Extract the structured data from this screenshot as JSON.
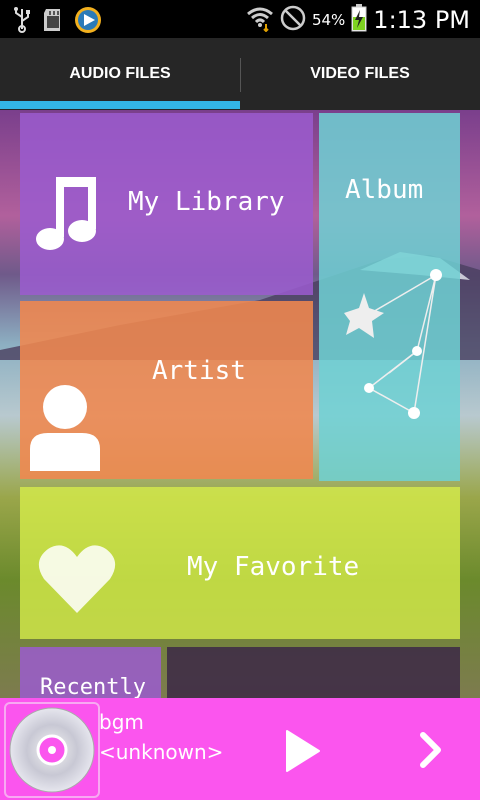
{
  "status_bar": {
    "battery_percent": "54%",
    "time": "1:13 PM",
    "icons": [
      "usb-icon",
      "sd-card-icon",
      "media-app-icon",
      "wifi-icon",
      "no-signal-icon",
      "battery-charging-icon"
    ]
  },
  "tabs": [
    {
      "label": "AUDIO FILES",
      "selected": true
    },
    {
      "label": "VIDEO FILES",
      "selected": false
    }
  ],
  "tiles": {
    "library": {
      "label": "My Library",
      "icon": "music-note-icon",
      "color": "#9b5ccf"
    },
    "album": {
      "label": "Album",
      "icon": "constellation-icon",
      "color": "#6fd1d3"
    },
    "artist": {
      "label": "Artist",
      "icon": "person-icon",
      "color": "#f0874f"
    },
    "favorite": {
      "label": "My Favorite",
      "icon": "heart-icon",
      "color": "#d7ee4a"
    },
    "recently": {
      "label": "Recently",
      "color": "#9b5ccf"
    }
  },
  "now_playing": {
    "title": "bgm",
    "artist": "<unknown>",
    "icons": [
      "disc-icon",
      "play-icon",
      "next-icon"
    ],
    "bar_color": "#fb55ee"
  }
}
